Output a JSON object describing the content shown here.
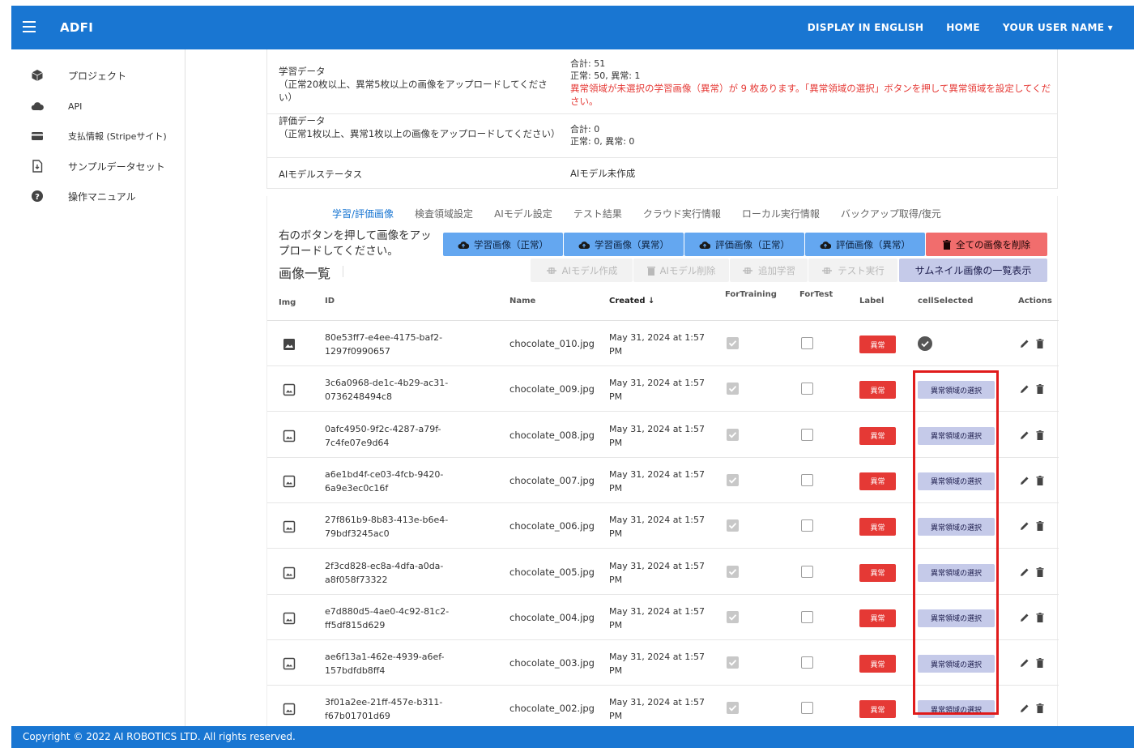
{
  "app": {
    "brand": "ADFI",
    "nav": {
      "english": "DISPLAY IN ENGLISH",
      "home": "HOME",
      "user": "YOUR USER NAME ▾"
    }
  },
  "sidebar": {
    "items": [
      {
        "label": "プロジェクト",
        "icon": "cube-icon"
      },
      {
        "label": "API",
        "icon": "cloud-check-icon"
      },
      {
        "label": "支払情報 (Stripeサイト)",
        "icon": "credit-card-icon"
      },
      {
        "label": "サンプルデータセット",
        "icon": "file-download-icon"
      },
      {
        "label": "操作マニュアル",
        "icon": "help-circle-icon"
      }
    ]
  },
  "summary": {
    "training": {
      "label": "学習データ\n（正常20枚以上、異常5枚以上の画像をアップロードしてください）",
      "total": "合計: 51",
      "counts": "正常: 50, 異常: 1",
      "warning": "異常領域が未選択の学習画像（異常）が 9 枚あります。「異常領域の選択」ボタンを押して異常領域を設定してください。"
    },
    "evaluation": {
      "label": "評価データ\n（正常1枚以上、異常1枚以上の画像をアップロードしてください）",
      "total": "合計: 0",
      "counts": "正常: 0, 異常: 0"
    },
    "status": {
      "label": "AIモデルステータス",
      "value": "AIモデル未作成"
    }
  },
  "tabs": [
    "学習/評価画像",
    "検査領域設定",
    "AIモデル設定",
    "テスト結果",
    "クラウド実行情報",
    "ローカル実行情報",
    "バックアップ取得/復元"
  ],
  "upload_note": "右のボタンを押して画像をアップロードしてください。",
  "list_title": "画像一覧",
  "buttons": {
    "train_normal": "学習画像（正常）",
    "train_abnormal": "学習画像（異常）",
    "eval_normal": "評価画像（正常）",
    "eval_abnormal": "評価画像（異常）",
    "delete_all": "全ての画像を削除",
    "create_model": "AIモデル作成",
    "delete_model": "AIモデル削除",
    "additional_training": "追加学習",
    "run_test": "テスト実行",
    "thumbnails": "サムネイル画像の一覧表示"
  },
  "table": {
    "headers": {
      "img": "Img",
      "id": "ID",
      "name": "Name",
      "created": "Created ↓",
      "for_training": "ForTraining",
      "for_test": "ForTest",
      "label": "Label",
      "cell_selected": "cellSelected",
      "actions": "Actions"
    },
    "select_label": "異常領域の選択",
    "rows": [
      {
        "id": "80e53ff7-e4ee-4175-baf2-1297f0990657",
        "name": "chocolate_010.jpg",
        "created": "May 31, 2024 at 1:57 PM",
        "label": "異常",
        "selected": true,
        "thumb": "filled"
      },
      {
        "id": "3c6a0968-de1c-4b29-ac31-0736248494c8",
        "name": "chocolate_009.jpg",
        "created": "May 31, 2024 at 1:57 PM",
        "label": "異常",
        "selected": false,
        "thumb": "outline"
      },
      {
        "id": "0afc4950-9f2c-4287-a79f-7c4fe07e9d64",
        "name": "chocolate_008.jpg",
        "created": "May 31, 2024 at 1:57 PM",
        "label": "異常",
        "selected": false,
        "thumb": "outline"
      },
      {
        "id": "a6e1bd4f-ce03-4fcb-9420-6a9e3ec0c16f",
        "name": "chocolate_007.jpg",
        "created": "May 31, 2024 at 1:57 PM",
        "label": "異常",
        "selected": false,
        "thumb": "outline"
      },
      {
        "id": "27f861b9-8b83-413e-b6e4-79bdf3245ac0",
        "name": "chocolate_006.jpg",
        "created": "May 31, 2024 at 1:57 PM",
        "label": "異常",
        "selected": false,
        "thumb": "outline"
      },
      {
        "id": "2f3cd828-ec8a-4dfa-a0da-a8f058f73322",
        "name": "chocolate_005.jpg",
        "created": "May 31, 2024 at 1:57 PM",
        "label": "異常",
        "selected": false,
        "thumb": "outline"
      },
      {
        "id": "e7d880d5-4ae0-4c92-81c2-ff5df815d629",
        "name": "chocolate_004.jpg",
        "created": "May 31, 2024 at 1:57 PM",
        "label": "異常",
        "selected": false,
        "thumb": "outline"
      },
      {
        "id": "ae6f13a1-462e-4939-a6ef-157bdfdb8ff4",
        "name": "chocolate_003.jpg",
        "created": "May 31, 2024 at 1:57 PM",
        "label": "異常",
        "selected": false,
        "thumb": "outline"
      },
      {
        "id": "3f01a2ee-21ff-457e-b311-f67b01701d69",
        "name": "chocolate_002.jpg",
        "created": "May 31, 2024 at 1:57 PM",
        "label": "異常",
        "selected": false,
        "thumb": "outline"
      }
    ]
  },
  "footer": "Copyright © 2022 AI ROBOTICS LTD. All rights reserved.",
  "colors": {
    "primary": "#1976d2",
    "danger": "#e53935",
    "upload": "#64a7f0",
    "lavender": "#c5cae9",
    "highlight": "#e01b1b"
  }
}
